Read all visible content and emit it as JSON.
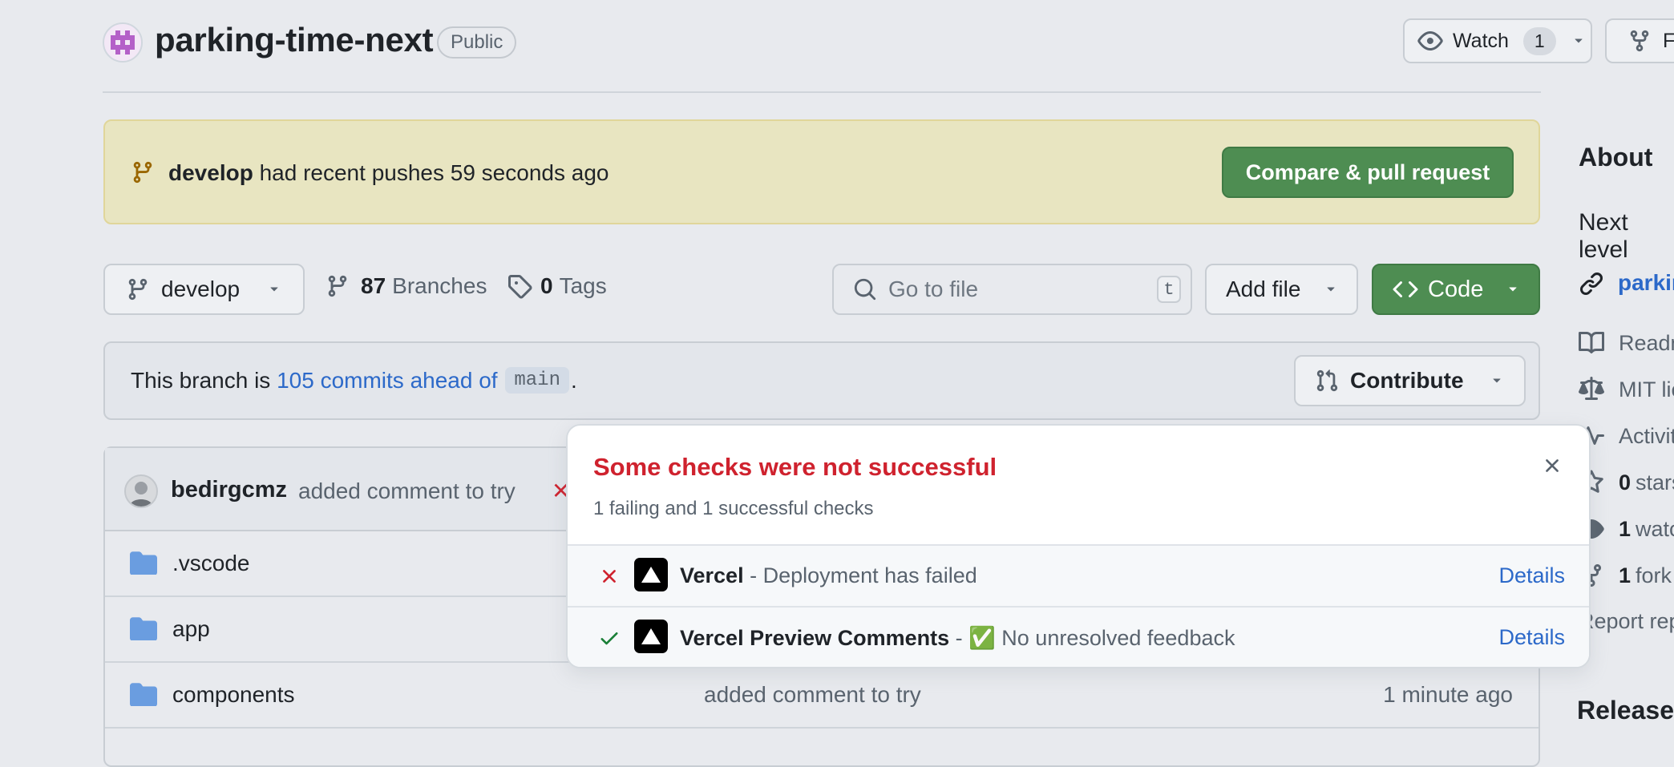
{
  "repo": {
    "name": "parking-time-next",
    "visibility": "Public"
  },
  "header": {
    "watch_label": "Watch",
    "watch_count": "1",
    "fork_label": "Fork"
  },
  "banner": {
    "branch": "develop",
    "text": " had recent pushes 59 seconds ago",
    "button": "Compare & pull request"
  },
  "toolbar": {
    "branch": "develop",
    "branches_count": "87",
    "branches_label": "Branches",
    "tags_count": "0",
    "tags_label": "Tags",
    "search_placeholder": "Go to file",
    "search_shortcut": "t",
    "add_file": "Add file",
    "code": "Code"
  },
  "ahead": {
    "prefix": "This branch is ",
    "link": "105 commits ahead of",
    "base": "main",
    "suffix": ".",
    "contribute": "Contribute"
  },
  "commit": {
    "author": "bedirgcmz",
    "message": "added comment to try",
    "status_icon": "✕"
  },
  "files": [
    {
      "name": ".vscode",
      "commit": "",
      "time": ""
    },
    {
      "name": "app",
      "commit": "",
      "time": ""
    },
    {
      "name": "components",
      "commit": "added comment to try",
      "time": "1 minute ago"
    }
  ],
  "checks": {
    "title": "Some checks were not successful",
    "subtitle": "1 failing and 1 successful checks",
    "items": [
      {
        "status": "fail",
        "name": "Vercel",
        "desc": " - Deployment has failed",
        "details": "Details"
      },
      {
        "status": "success",
        "name": "Vercel Preview Comments",
        "desc": " - ✅ No unresolved feedback",
        "details": "Details"
      }
    ]
  },
  "sidebar": {
    "about": "About",
    "description": "Next level",
    "link": "parking",
    "readme": "Readme",
    "license": "MIT license",
    "activity": "Activity",
    "stars_count": "0",
    "stars_label": "stars",
    "watching_count": "1",
    "watching_label": "watching",
    "forks_count": "1",
    "forks_label": "fork",
    "report": "Report repository",
    "releases": "Releases"
  },
  "colors": {
    "accent_green": "#4e8d52",
    "link_blue": "#2c69c9",
    "danger_red": "#cf222e",
    "banner_bg": "#e8e5c1"
  }
}
